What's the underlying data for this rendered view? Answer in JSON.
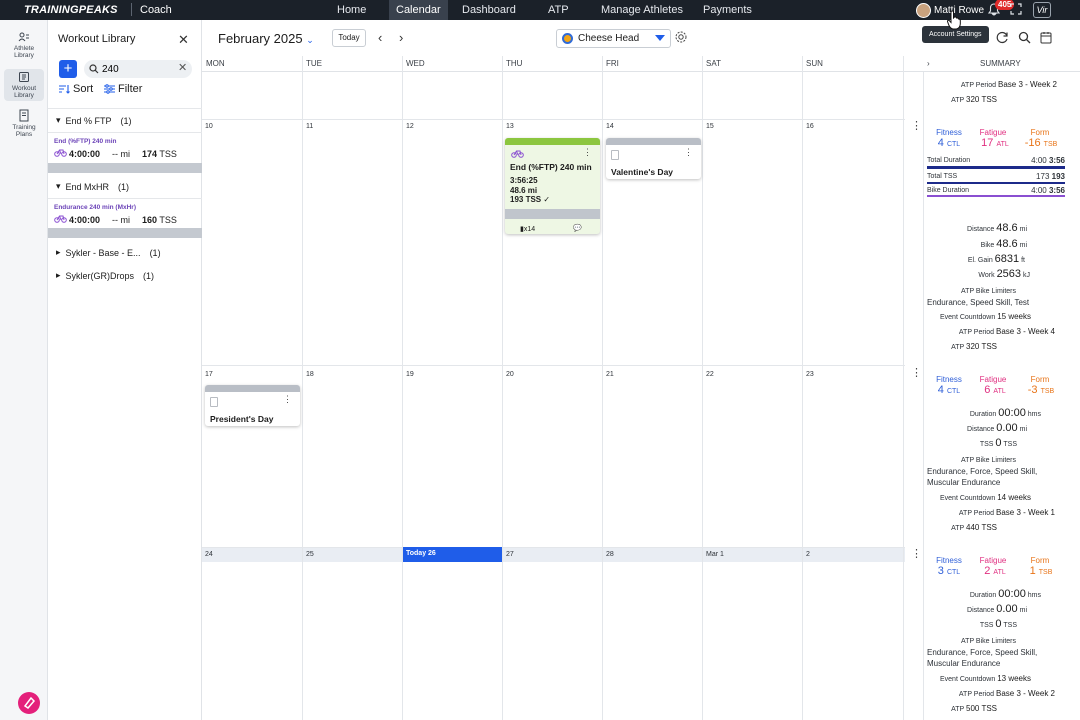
{
  "topbar": {
    "brand": "TRAININGPEAKS",
    "product": "Coach",
    "nav": [
      "Home",
      "Calendar",
      "Dashboard",
      "ATP",
      "Manage Athletes",
      "Payments"
    ],
    "active_nav": "Calendar",
    "user_name": "Matti Rowe",
    "notification_count": "405",
    "vir_label": "Vir",
    "tooltip": "Account Settings"
  },
  "rail": {
    "items": [
      {
        "label": "Athlete Library",
        "icon": "athlete-library-icon"
      },
      {
        "label": "Workout Library",
        "icon": "workout-library-icon"
      },
      {
        "label": "Training Plans",
        "icon": "training-plans-icon"
      }
    ]
  },
  "library": {
    "title": "Workout Library",
    "search_value": "240",
    "sort_label": "Sort",
    "filter_label": "Filter",
    "groups": [
      {
        "name": "End % FTP",
        "count": "(1)",
        "expanded": true,
        "workout": {
          "name": "End (%FTP) 240 min",
          "duration": "4:00:00",
          "distance": "-- mi",
          "tss": "174",
          "tss_unit": "TSS"
        }
      },
      {
        "name": "End MxHR",
        "count": "(1)",
        "expanded": true,
        "workout": {
          "name": "Endurance 240 min (MxHr)",
          "duration": "4:00:00",
          "distance": "-- mi",
          "tss": "160",
          "tss_unit": "TSS"
        }
      },
      {
        "name": "Sykler - Base - E...",
        "count": "(1)",
        "expanded": false
      },
      {
        "name": "Sykler(GR)Drops",
        "count": "(1)",
        "expanded": false
      }
    ]
  },
  "calendar": {
    "month": "February 2025",
    "today_label": "Today",
    "athlete": "Cheese Head",
    "days": [
      "MON",
      "TUE",
      "WED",
      "THU",
      "FRI",
      "SAT",
      "SUN"
    ],
    "summary_header": "SUMMARY",
    "weeks": [
      {
        "dates": [
          "",
          "",
          "",
          "",
          "",
          "",
          ""
        ]
      },
      {
        "dates": [
          "10",
          "11",
          "12",
          "13",
          "14",
          "15",
          "16"
        ]
      },
      {
        "dates": [
          "17",
          "18",
          "19",
          "20",
          "21",
          "22",
          "23"
        ]
      },
      {
        "dates": [
          "24",
          "25",
          "Today 26",
          "27",
          "28",
          "Mar 1",
          "2"
        ]
      }
    ],
    "workout_card": {
      "title": "End (%FTP) 240 min",
      "duration": "3:56:25",
      "distance": "48.6 mi",
      "tss": "193 TSS",
      "device_count": "x14"
    },
    "notes": [
      {
        "title": "Valentine's Day"
      },
      {
        "title": "President's Day"
      }
    ]
  },
  "summary": {
    "week0": {
      "atp_period_label": "ATP Period",
      "atp_period": "Base 3 - Week 2",
      "atp_label": "ATP",
      "atp": "320 TSS"
    },
    "week1": {
      "fitness_label": "Fitness",
      "fitness": "4",
      "fitness_unit": "CTL",
      "fatigue_label": "Fatigue",
      "fatigue": "17",
      "fatigue_unit": "ATL",
      "form_label": "Form",
      "form": "-16",
      "form_unit": "TSB",
      "total_duration_label": "Total Duration",
      "total_duration_planned": "4:00",
      "total_duration_actual": "3:56",
      "total_tss_label": "Total TSS",
      "total_tss_planned": "173",
      "total_tss_actual": "193",
      "bike_duration_label": "Bike Duration",
      "bike_duration_planned": "4:00",
      "bike_duration_actual": "3:56",
      "distance_label": "Distance",
      "distance": "48.6",
      "distance_unit": "mi",
      "bike_label": "Bike",
      "bike": "48.6",
      "bike_unit": "mi",
      "el_gain_label": "El. Gain",
      "el_gain": "6831",
      "el_gain_unit": "ft",
      "work_label": "Work",
      "work": "2563",
      "work_unit": "kJ",
      "limiters_label": "ATP Bike Limiters",
      "limiters": "Endurance, Speed Skill, Test",
      "countdown_label": "Event Countdown",
      "countdown": "15 weeks",
      "atp_period_label": "ATP Period",
      "atp_period": "Base 3 - Week 4",
      "atp_label": "ATP",
      "atp": "320 TSS"
    },
    "week2": {
      "fitness_label": "Fitness",
      "fitness": "4",
      "fitness_unit": "CTL",
      "fatigue_label": "Fatigue",
      "fatigue": "6",
      "fatigue_unit": "ATL",
      "form_label": "Form",
      "form": "-3",
      "form_unit": "TSB",
      "duration_label": "Duration",
      "duration": "00:00",
      "duration_unit": "hms",
      "distance_label": "Distance",
      "distance": "0.00",
      "distance_unit": "mi",
      "tss_label": "TSS",
      "tss": "0",
      "tss_unit": "TSS",
      "limiters_label": "ATP Bike Limiters",
      "limiters": "Endurance, Force, Speed Skill, Muscular Endurance",
      "countdown_label": "Event Countdown",
      "countdown": "14 weeks",
      "atp_period_label": "ATP Period",
      "atp_period": "Base 3 - Week 1",
      "atp_label": "ATP",
      "atp": "440 TSS"
    },
    "week3": {
      "fitness_label": "Fitness",
      "fitness": "3",
      "fitness_unit": "CTL",
      "fatigue_label": "Fatigue",
      "fatigue": "2",
      "fatigue_unit": "ATL",
      "form_label": "Form",
      "form": "1",
      "form_unit": "TSB",
      "duration_label": "Duration",
      "duration": "00:00",
      "duration_unit": "hms",
      "distance_label": "Distance",
      "distance": "0.00",
      "distance_unit": "mi",
      "tss_label": "TSS",
      "tss": "0",
      "tss_unit": "TSS",
      "limiters_label": "ATP Bike Limiters",
      "limiters": "Endurance, Force, Speed Skill, Muscular Endurance",
      "countdown_label": "Event Countdown",
      "countdown": "13 weeks",
      "atp_period_label": "ATP Period",
      "atp_period": "Base 3 - Week 2",
      "atp_label": "ATP",
      "atp": "500 TSS"
    }
  },
  "colors": {
    "accent": "#1f5de9",
    "topbar": "#1b2129",
    "workout_green": "#8cc63f",
    "fitness": "#2f5fd8",
    "fatigue": "#e02f80",
    "form": "#e87418"
  }
}
